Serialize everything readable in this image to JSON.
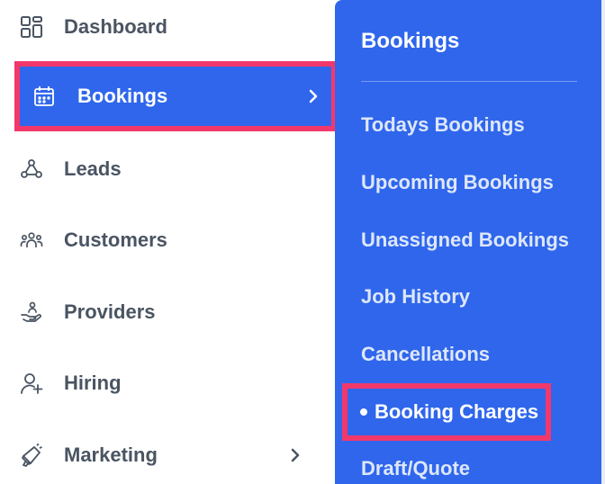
{
  "sidebar": {
    "items": [
      {
        "label": "Dashboard",
        "icon": "dashboard-grid-icon"
      },
      {
        "label": "Bookings",
        "icon": "calendar-icon",
        "active": true
      },
      {
        "label": "Leads",
        "icon": "leads-network-icon"
      },
      {
        "label": "Customers",
        "icon": "customers-group-icon"
      },
      {
        "label": "Providers",
        "icon": "providers-hand-icon"
      },
      {
        "label": "Hiring",
        "icon": "hiring-user-plus-icon"
      },
      {
        "label": "Marketing",
        "icon": "megaphone-icon"
      }
    ]
  },
  "flyout": {
    "title": "Bookings",
    "items": [
      {
        "label": "Todays Bookings"
      },
      {
        "label": "Upcoming Bookings"
      },
      {
        "label": "Unassigned Bookings"
      },
      {
        "label": "Job History"
      },
      {
        "label": "Cancellations"
      },
      {
        "label": "Booking Charges",
        "selected": true
      },
      {
        "label": "Draft/Quote"
      }
    ]
  },
  "colors": {
    "accent": "#2f66ec",
    "highlight": "#f2386b",
    "text": "#4a5462"
  }
}
